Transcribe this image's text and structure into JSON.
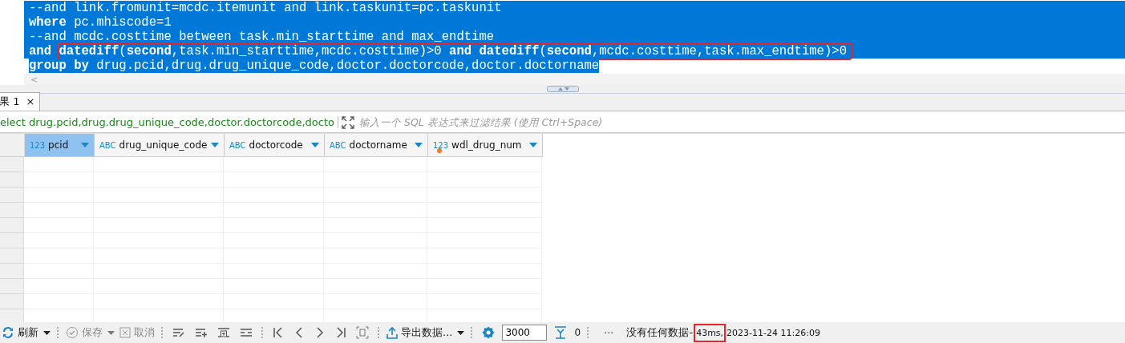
{
  "editor": {
    "lines": [
      {
        "selected": true,
        "full_width": true,
        "parts": [
          {
            "boxed": false,
            "tokens": [
              {
                "text": "--and link.fromunit=mcdc.itemunit and link.taskunit=pc.taskunit",
                "kind": "plain"
              }
            ]
          }
        ]
      },
      {
        "selected": true,
        "full_width": true,
        "parts": [
          {
            "boxed": false,
            "tokens": [
              {
                "text": "where",
                "kind": "keyword"
              },
              {
                "text": " pc.mhiscode=1",
                "kind": "plain"
              }
            ]
          }
        ]
      },
      {
        "selected": true,
        "full_width": true,
        "parts": [
          {
            "boxed": false,
            "tokens": [
              {
                "text": "--and mcdc.costtime between task.min_starttime and max_endtime",
                "kind": "plain"
              }
            ]
          }
        ]
      },
      {
        "selected": true,
        "full_width": true,
        "parts": [
          {
            "boxed": false,
            "tokens": [
              {
                "text": "and ",
                "kind": "keyword"
              }
            ]
          },
          {
            "boxed": true,
            "tokens": [
              {
                "text": "datediff",
                "kind": "keyword"
              },
              {
                "text": "(",
                "kind": "plain"
              },
              {
                "text": "second",
                "kind": "keyword"
              },
              {
                "text": ",task.min_starttime,mcdc.costtime)>0 ",
                "kind": "plain"
              },
              {
                "text": "and datediff",
                "kind": "keyword"
              },
              {
                "text": "(",
                "kind": "plain"
              },
              {
                "text": "second",
                "kind": "keyword"
              },
              {
                "text": ",mcdc.costtime,task.max_endtime)>0",
                "kind": "plain"
              }
            ]
          }
        ]
      },
      {
        "selected": true,
        "full_width": false,
        "parts": [
          {
            "boxed": false,
            "tokens": [
              {
                "text": "group by",
                "kind": "keyword"
              },
              {
                "text": " drug.pcid,drug.drug_unique_code,doctor.doctorcode,doctor.doctorname",
                "kind": "plain"
              }
            ]
          }
        ]
      }
    ],
    "scroll_left": "<"
  },
  "tab": {
    "label": "果 1",
    "close": "×",
    "selected": true
  },
  "filter": {
    "query": "elect drug.pcid,drug.drug_unique_code,doctor.doctorcode,docto",
    "placeholder": "输入一个 SQL 表达式来过滤结果 (使用 Ctrl+Space)"
  },
  "columns": [
    {
      "type_label": "123",
      "name": "pcid",
      "selected": true,
      "flagged": false
    },
    {
      "type_label": "ABC",
      "name": "drug_unique_code",
      "selected": false,
      "flagged": false
    },
    {
      "type_label": "ABC",
      "name": "doctorcode",
      "selected": false,
      "flagged": false
    },
    {
      "type_label": "ABC",
      "name": "doctorname",
      "selected": false,
      "flagged": false
    },
    {
      "type_label": "123",
      "name": "wdl_drug_num",
      "selected": false,
      "flagged": true
    }
  ],
  "toolbar": {
    "refresh": {
      "label": "刷新",
      "disabled": false
    },
    "save": {
      "label": "保存",
      "disabled": true
    },
    "cancel": {
      "label": "取消",
      "disabled": true
    },
    "export": {
      "label": "导出数据...",
      "disabled": false
    },
    "fetch_size": "3000",
    "fetched": "0",
    "more": "···",
    "status": [
      {
        "text": "没有任何数据-",
        "boxed": false
      },
      {
        "text": "43ms,",
        "boxed": true
      },
      {
        "text": "2023-11-24 11:26:09",
        "boxed": false
      }
    ]
  }
}
